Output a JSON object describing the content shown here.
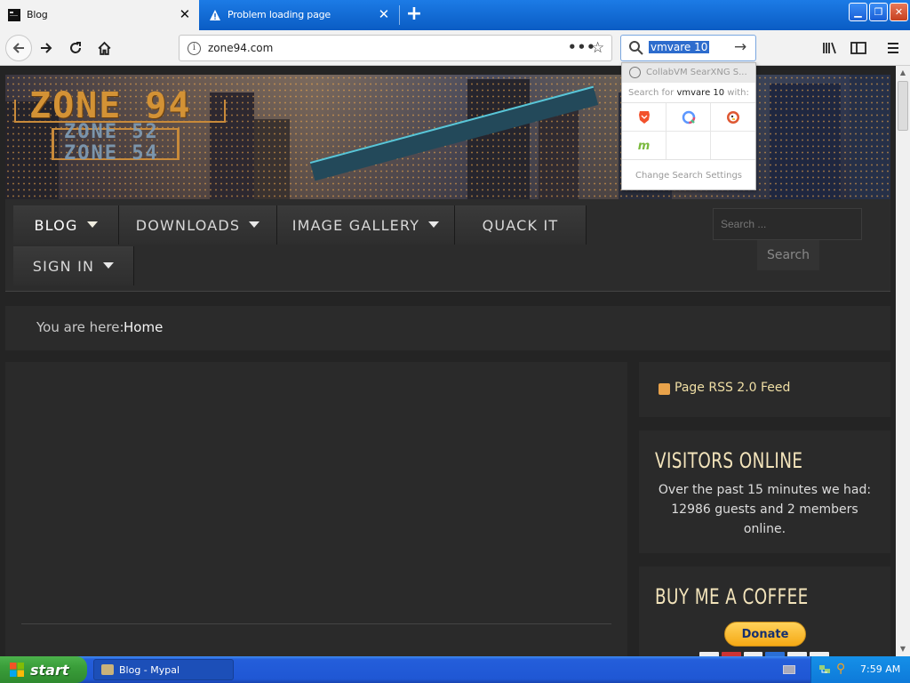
{
  "browser": {
    "tabs": [
      {
        "label": "Blog",
        "active": true,
        "icon": "favicon-icon"
      },
      {
        "label": "Problem loading page",
        "active": false,
        "icon": "warning-icon"
      }
    ],
    "new_tab_label": "+",
    "url": "zone94.com",
    "page_actions_label": "•••",
    "search_value": "vmvare 10",
    "window_controls": [
      "minimize",
      "restore",
      "close"
    ]
  },
  "search_popup": {
    "suggestion": "CollabVM SearXNG S...",
    "search_for_prefix": "Search for ",
    "search_for_query": "vmvare 10",
    "search_for_suffix": " with:",
    "engines": [
      {
        "name": "Brave",
        "icon": "brave-lion-icon",
        "color": "#f2512c"
      },
      {
        "name": "Qwant",
        "icon": "qwant-q-icon",
        "color": "#5c97ff"
      },
      {
        "name": "DuckDuckGo",
        "icon": "duck-icon",
        "color": "#de5833"
      },
      {
        "name": "Mojeek",
        "icon": "mojeek-m-icon",
        "color": "#7ab93d"
      }
    ],
    "settings_label": "Change Search Settings"
  },
  "site": {
    "logo_main": "ZONE 94",
    "logo_sub1": "ZONE 52",
    "logo_sub2": "ZONE 54",
    "menu": [
      {
        "label": "BLOG",
        "has_caret": true,
        "active": true
      },
      {
        "label": "DOWNLOADS",
        "has_caret": true,
        "active": false
      },
      {
        "label": "IMAGE GALLERY",
        "has_caret": true,
        "active": false
      },
      {
        "label": "QUACK IT",
        "has_caret": false,
        "active": false
      },
      {
        "label": "SIGN IN",
        "has_caret": true,
        "active": false
      }
    ],
    "search_placeholder": "Search ...",
    "search_button": "Search",
    "breadcrumb_label": "You are here:",
    "breadcrumb_home": "Home",
    "rss_label": "Page RSS 2.0 Feed",
    "visitors_title": "VISITORS ONLINE",
    "visitors_text": "Over the past 15 minutes we had: 12986 guests and 2 members online.",
    "coffee_title": "BUY ME A COFFEE",
    "donate_label": "Donate"
  },
  "taskbar": {
    "start_label": "start",
    "task_label": "Blog - Mypal",
    "clock": "7:59 AM"
  },
  "colors": {
    "accent_gold": "#f3e4bb",
    "logo_orange": "#d39235",
    "xp_blue": "#245edb",
    "page_bg": "#242424"
  }
}
